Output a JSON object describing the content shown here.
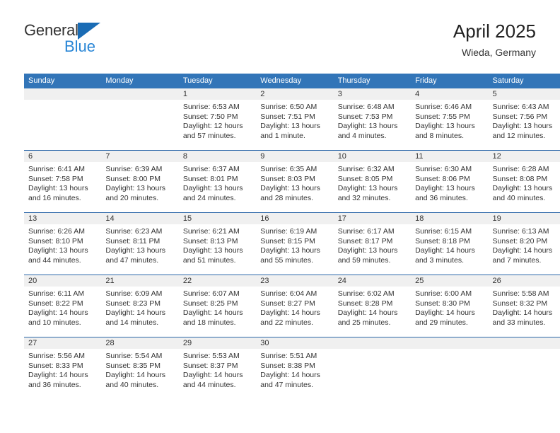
{
  "brand": {
    "name_part1": "General",
    "name_part2": "Blue",
    "triangle_icon": "blue-triangle-icon",
    "accent_color": "#2986d6"
  },
  "header": {
    "title": "April 2025",
    "subtitle": "Wieda, Germany"
  },
  "theme": {
    "header_blue": "#3275b8",
    "row_divider_blue": "#2a66a8",
    "daynum_band": "#f0f0f0"
  },
  "calendar": {
    "weekday_headers": [
      "Sunday",
      "Monday",
      "Tuesday",
      "Wednesday",
      "Thursday",
      "Friday",
      "Saturday"
    ],
    "weeks": [
      [
        {
          "day": "",
          "sunrise": "",
          "sunset": "",
          "daylight": ""
        },
        {
          "day": "",
          "sunrise": "",
          "sunset": "",
          "daylight": ""
        },
        {
          "day": "1",
          "sunrise": "Sunrise: 6:53 AM",
          "sunset": "Sunset: 7:50 PM",
          "daylight": "Daylight: 12 hours and 57 minutes."
        },
        {
          "day": "2",
          "sunrise": "Sunrise: 6:50 AM",
          "sunset": "Sunset: 7:51 PM",
          "daylight": "Daylight: 13 hours and 1 minute."
        },
        {
          "day": "3",
          "sunrise": "Sunrise: 6:48 AM",
          "sunset": "Sunset: 7:53 PM",
          "daylight": "Daylight: 13 hours and 4 minutes."
        },
        {
          "day": "4",
          "sunrise": "Sunrise: 6:46 AM",
          "sunset": "Sunset: 7:55 PM",
          "daylight": "Daylight: 13 hours and 8 minutes."
        },
        {
          "day": "5",
          "sunrise": "Sunrise: 6:43 AM",
          "sunset": "Sunset: 7:56 PM",
          "daylight": "Daylight: 13 hours and 12 minutes."
        }
      ],
      [
        {
          "day": "6",
          "sunrise": "Sunrise: 6:41 AM",
          "sunset": "Sunset: 7:58 PM",
          "daylight": "Daylight: 13 hours and 16 minutes."
        },
        {
          "day": "7",
          "sunrise": "Sunrise: 6:39 AM",
          "sunset": "Sunset: 8:00 PM",
          "daylight": "Daylight: 13 hours and 20 minutes."
        },
        {
          "day": "8",
          "sunrise": "Sunrise: 6:37 AM",
          "sunset": "Sunset: 8:01 PM",
          "daylight": "Daylight: 13 hours and 24 minutes."
        },
        {
          "day": "9",
          "sunrise": "Sunrise: 6:35 AM",
          "sunset": "Sunset: 8:03 PM",
          "daylight": "Daylight: 13 hours and 28 minutes."
        },
        {
          "day": "10",
          "sunrise": "Sunrise: 6:32 AM",
          "sunset": "Sunset: 8:05 PM",
          "daylight": "Daylight: 13 hours and 32 minutes."
        },
        {
          "day": "11",
          "sunrise": "Sunrise: 6:30 AM",
          "sunset": "Sunset: 8:06 PM",
          "daylight": "Daylight: 13 hours and 36 minutes."
        },
        {
          "day": "12",
          "sunrise": "Sunrise: 6:28 AM",
          "sunset": "Sunset: 8:08 PM",
          "daylight": "Daylight: 13 hours and 40 minutes."
        }
      ],
      [
        {
          "day": "13",
          "sunrise": "Sunrise: 6:26 AM",
          "sunset": "Sunset: 8:10 PM",
          "daylight": "Daylight: 13 hours and 44 minutes."
        },
        {
          "day": "14",
          "sunrise": "Sunrise: 6:23 AM",
          "sunset": "Sunset: 8:11 PM",
          "daylight": "Daylight: 13 hours and 47 minutes."
        },
        {
          "day": "15",
          "sunrise": "Sunrise: 6:21 AM",
          "sunset": "Sunset: 8:13 PM",
          "daylight": "Daylight: 13 hours and 51 minutes."
        },
        {
          "day": "16",
          "sunrise": "Sunrise: 6:19 AM",
          "sunset": "Sunset: 8:15 PM",
          "daylight": "Daylight: 13 hours and 55 minutes."
        },
        {
          "day": "17",
          "sunrise": "Sunrise: 6:17 AM",
          "sunset": "Sunset: 8:17 PM",
          "daylight": "Daylight: 13 hours and 59 minutes."
        },
        {
          "day": "18",
          "sunrise": "Sunrise: 6:15 AM",
          "sunset": "Sunset: 8:18 PM",
          "daylight": "Daylight: 14 hours and 3 minutes."
        },
        {
          "day": "19",
          "sunrise": "Sunrise: 6:13 AM",
          "sunset": "Sunset: 8:20 PM",
          "daylight": "Daylight: 14 hours and 7 minutes."
        }
      ],
      [
        {
          "day": "20",
          "sunrise": "Sunrise: 6:11 AM",
          "sunset": "Sunset: 8:22 PM",
          "daylight": "Daylight: 14 hours and 10 minutes."
        },
        {
          "day": "21",
          "sunrise": "Sunrise: 6:09 AM",
          "sunset": "Sunset: 8:23 PM",
          "daylight": "Daylight: 14 hours and 14 minutes."
        },
        {
          "day": "22",
          "sunrise": "Sunrise: 6:07 AM",
          "sunset": "Sunset: 8:25 PM",
          "daylight": "Daylight: 14 hours and 18 minutes."
        },
        {
          "day": "23",
          "sunrise": "Sunrise: 6:04 AM",
          "sunset": "Sunset: 8:27 PM",
          "daylight": "Daylight: 14 hours and 22 minutes."
        },
        {
          "day": "24",
          "sunrise": "Sunrise: 6:02 AM",
          "sunset": "Sunset: 8:28 PM",
          "daylight": "Daylight: 14 hours and 25 minutes."
        },
        {
          "day": "25",
          "sunrise": "Sunrise: 6:00 AM",
          "sunset": "Sunset: 8:30 PM",
          "daylight": "Daylight: 14 hours and 29 minutes."
        },
        {
          "day": "26",
          "sunrise": "Sunrise: 5:58 AM",
          "sunset": "Sunset: 8:32 PM",
          "daylight": "Daylight: 14 hours and 33 minutes."
        }
      ],
      [
        {
          "day": "27",
          "sunrise": "Sunrise: 5:56 AM",
          "sunset": "Sunset: 8:33 PM",
          "daylight": "Daylight: 14 hours and 36 minutes."
        },
        {
          "day": "28",
          "sunrise": "Sunrise: 5:54 AM",
          "sunset": "Sunset: 8:35 PM",
          "daylight": "Daylight: 14 hours and 40 minutes."
        },
        {
          "day": "29",
          "sunrise": "Sunrise: 5:53 AM",
          "sunset": "Sunset: 8:37 PM",
          "daylight": "Daylight: 14 hours and 44 minutes."
        },
        {
          "day": "30",
          "sunrise": "Sunrise: 5:51 AM",
          "sunset": "Sunset: 8:38 PM",
          "daylight": "Daylight: 14 hours and 47 minutes."
        },
        {
          "day": "",
          "sunrise": "",
          "sunset": "",
          "daylight": ""
        },
        {
          "day": "",
          "sunrise": "",
          "sunset": "",
          "daylight": ""
        },
        {
          "day": "",
          "sunrise": "",
          "sunset": "",
          "daylight": ""
        }
      ]
    ]
  }
}
